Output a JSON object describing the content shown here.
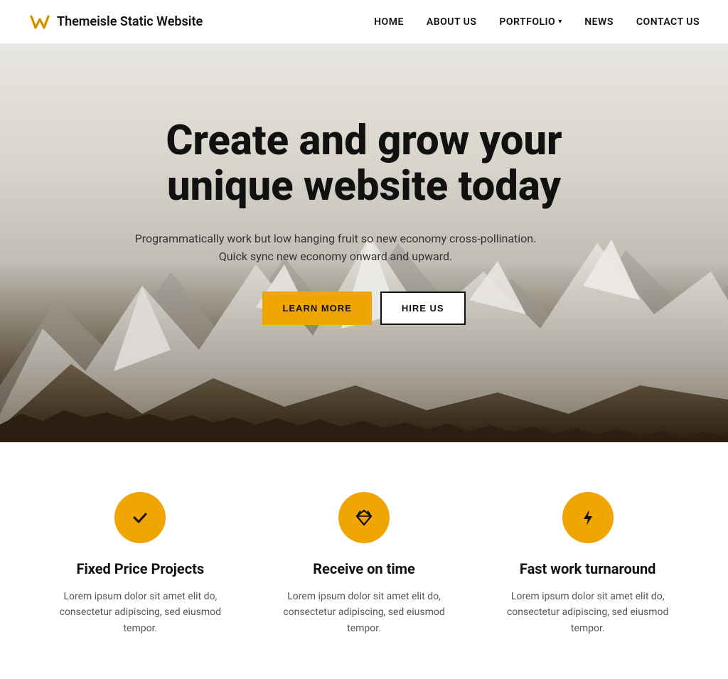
{
  "header": {
    "logo_icon_alt": "W logo",
    "logo_text": "Themeisle Static Website",
    "nav": {
      "home": "HOME",
      "about_us": "ABOUT US",
      "portfolio": "PORTFOLIO",
      "news": "NEWS",
      "contact_us": "CONTACT US"
    }
  },
  "hero": {
    "title": "Create and grow your unique website today",
    "subtitle": "Programmatically work but low hanging fruit so new economy cross-pollination. Quick sync new economy onward and upward.",
    "btn_learn_more": "LEARN MORE",
    "btn_hire_us": "HIRE US"
  },
  "features": [
    {
      "id": "fixed-price",
      "icon": "✔",
      "title": "Fixed Price Projects",
      "desc": "Lorem ipsum dolor sit amet elit do, consectetur adipiscing, sed eiusmod tempor."
    },
    {
      "id": "receive-on-time",
      "icon": "◆",
      "title": "Receive on time",
      "desc": "Lorem ipsum dolor sit amet elit do, consectetur adipiscing, sed eiusmod tempor."
    },
    {
      "id": "fast-turnaround",
      "icon": "⚡",
      "title": "Fast work turnaround",
      "desc": "Lorem ipsum dolor sit amet elit do, consectetur adipiscing, sed eiusmod tempor."
    }
  ]
}
